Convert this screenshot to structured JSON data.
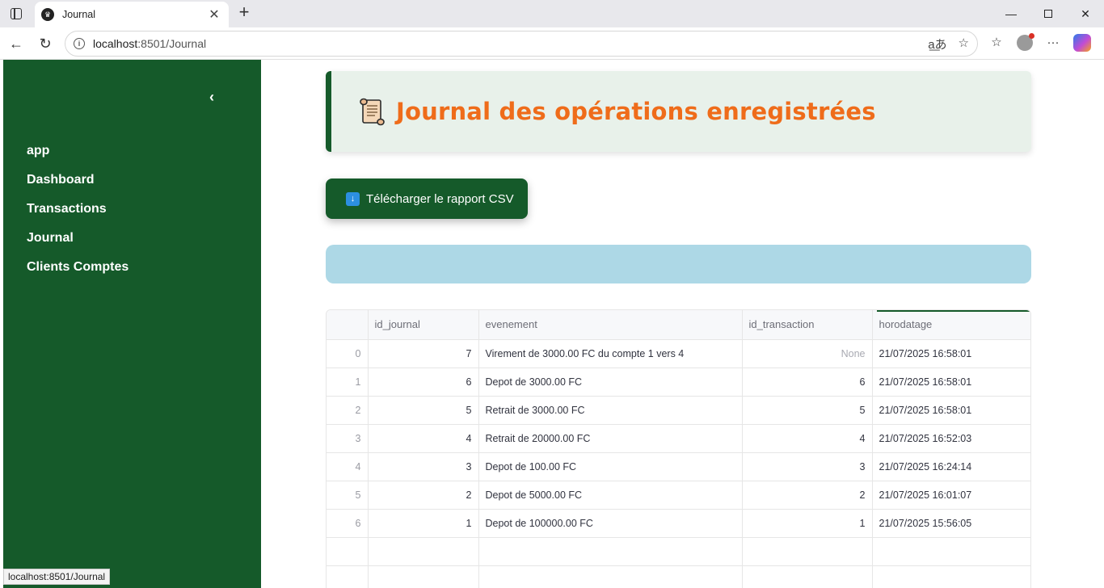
{
  "browser": {
    "tab_title": "Journal",
    "url_host": "localhost",
    "url_path": ":8501/Journal",
    "status_tip": "localhost:8501/Journal",
    "window_controls": {
      "minimize": "—",
      "close": "✕"
    },
    "new_tab": "+",
    "tab_close": "✕"
  },
  "sidebar": {
    "collapse_glyph": "‹",
    "items": [
      {
        "label": "app"
      },
      {
        "label": "Dashboard"
      },
      {
        "label": "Transactions"
      },
      {
        "label": "Journal"
      },
      {
        "label": "Clients Comptes"
      }
    ]
  },
  "header": {
    "title": "Journal des opérations enregistrées",
    "icon": "scroll-icon"
  },
  "download": {
    "label": "Télécharger le rapport CSV",
    "icon": "down-arrow-icon"
  },
  "table": {
    "columns": [
      "",
      "id_journal",
      "evenement",
      "id_transaction",
      "horodatage"
    ],
    "rows": [
      {
        "index": "0",
        "id_journal": "7",
        "evenement": "Virement de 3000.00 FC du compte 1 vers 4",
        "id_transaction": "None",
        "horodatage": "21/07/2025 16:58:01"
      },
      {
        "index": "1",
        "id_journal": "6",
        "evenement": "Depot de 3000.00 FC",
        "id_transaction": "6",
        "horodatage": "21/07/2025 16:58:01"
      },
      {
        "index": "2",
        "id_journal": "5",
        "evenement": "Retrait de 3000.00 FC",
        "id_transaction": "5",
        "horodatage": "21/07/2025 16:58:01"
      },
      {
        "index": "3",
        "id_journal": "4",
        "evenement": "Retrait de 20000.00 FC",
        "id_transaction": "4",
        "horodatage": "21/07/2025 16:52:03"
      },
      {
        "index": "4",
        "id_journal": "3",
        "evenement": "Depot de 100.00 FC",
        "id_transaction": "3",
        "horodatage": "21/07/2025 16:24:14"
      },
      {
        "index": "5",
        "id_journal": "2",
        "evenement": "Depot de 5000.00 FC",
        "id_transaction": "2",
        "horodatage": "21/07/2025 16:01:07"
      },
      {
        "index": "6",
        "id_journal": "1",
        "evenement": "Depot de 100000.00 FC",
        "id_transaction": "1",
        "horodatage": "21/07/2025 15:56:05"
      }
    ]
  },
  "colors": {
    "sidebar_bg": "#155a2a",
    "title_orange": "#ef6c1a",
    "header_bg": "#e8f1ea",
    "info_bar": "#add8e6"
  }
}
